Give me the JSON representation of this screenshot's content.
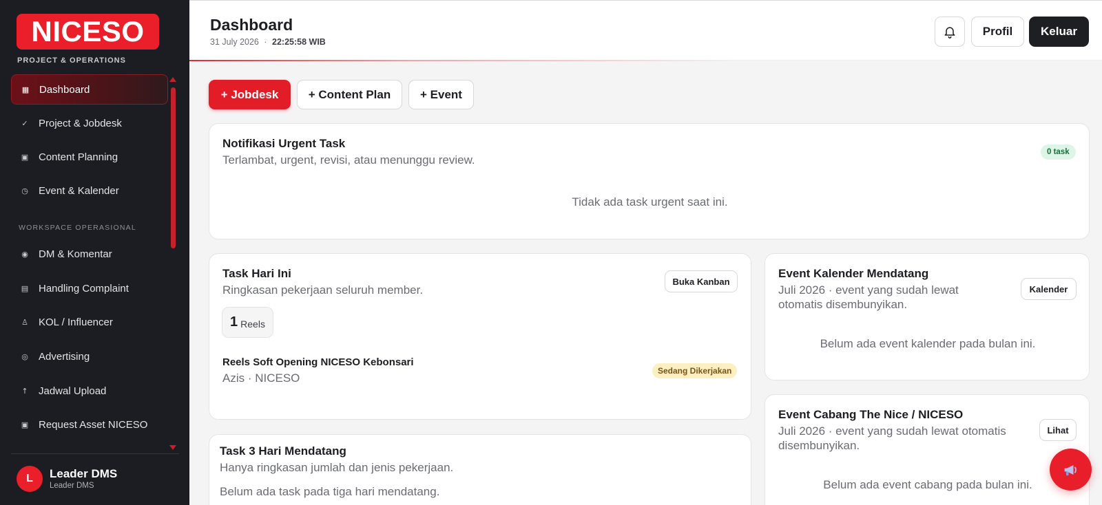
{
  "brand": {
    "logo": "NICESO",
    "subtitle": "PROJECT & OPERATIONS"
  },
  "sidebar": {
    "items": [
      {
        "label": "Dashboard",
        "icon": "grid-icon",
        "glyph": "▦"
      },
      {
        "label": "Project & Jobdesk",
        "icon": "check-icon",
        "glyph": "✓"
      },
      {
        "label": "Content Planning",
        "icon": "square-icon",
        "glyph": "▣"
      },
      {
        "label": "Event & Kalender",
        "icon": "clock-icon",
        "glyph": "◷"
      }
    ],
    "section_label": "WORKSPACE OPERASIONAL",
    "workspace_items": [
      {
        "label": "DM & Komentar",
        "icon": "dot-icon",
        "glyph": "◉"
      },
      {
        "label": "Handling Complaint",
        "icon": "list-icon",
        "glyph": "▤"
      },
      {
        "label": "KOL / Influencer",
        "icon": "person-icon",
        "glyph": "♙"
      },
      {
        "label": "Advertising",
        "icon": "target-icon",
        "glyph": "◎"
      },
      {
        "label": "Jadwal Upload",
        "icon": "arrow-up-icon",
        "glyph": "↑"
      },
      {
        "label": "Request Asset NICESO",
        "icon": "square-icon",
        "glyph": "▣"
      }
    ],
    "user": {
      "initial": "L",
      "name": "Leader DMS",
      "role": "Leader DMS"
    }
  },
  "header": {
    "title": "Dashboard",
    "date": "31 July 2026",
    "separator": "·",
    "time": "22:25:58 WIB",
    "profil_label": "Profil",
    "keluar_label": "Keluar"
  },
  "actions": {
    "jobdesk": "+ Jobdesk",
    "content_plan": "+ Content Plan",
    "event": "+ Event"
  },
  "urgent": {
    "title": "Notifikasi Urgent Task",
    "subtitle": "Terlambat, urgent, revisi, atau menunggu review.",
    "badge": "0 task",
    "empty": "Tidak ada task urgent saat ini."
  },
  "today": {
    "title": "Task Hari Ini",
    "subtitle": "Ringkasan pekerjaan seluruh member.",
    "button": "Buka Kanban",
    "count": "1",
    "count_label": "Reels",
    "task": {
      "title": "Reels Soft Opening NICESO Kebonsari",
      "meta": "Azis · NICESO",
      "status": "Sedang Dikerjakan"
    }
  },
  "next3": {
    "title": "Task 3 Hari Mendatang",
    "subtitle": "Hanya ringkasan jumlah dan jenis pekerjaan.",
    "empty": "Belum ada task pada tiga hari mendatang."
  },
  "calendar": {
    "title": "Event Kalender Mendatang",
    "subtitle_1": "Juli 2026 · event yang sudah lewat",
    "subtitle_2": "otomatis disembunyikan.",
    "button": "Kalender",
    "empty": "Belum ada event kalender pada bulan ini."
  },
  "branch": {
    "title": "Event Cabang The Nice / NICESO",
    "subtitle_1": "Juli 2026 · event yang sudah lewat otomatis",
    "subtitle_2": "disembunyikan.",
    "button": "Lihat",
    "empty": "Belum ada event cabang pada bulan ini."
  },
  "colors": {
    "accent": "#e21d27",
    "sidebar_bg": "#1b1d22",
    "dark_button": "#1e1f23"
  }
}
